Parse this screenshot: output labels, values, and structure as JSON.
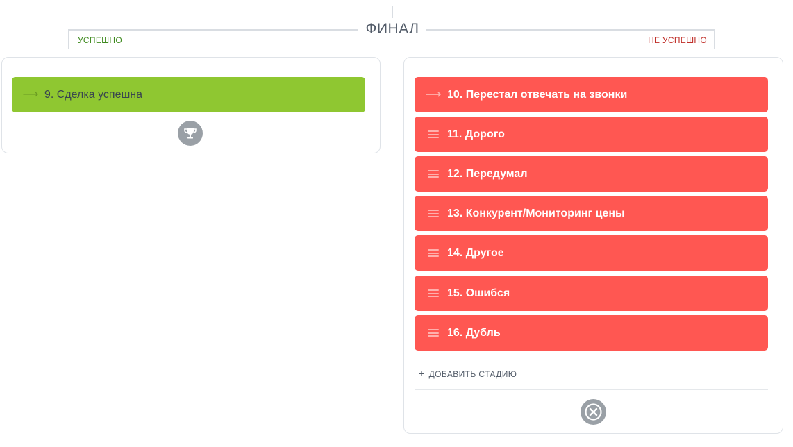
{
  "header": {
    "title": "ФИНАЛ",
    "success_label": "УСПЕШНО",
    "fail_label": "НЕ УСПЕШНО"
  },
  "success_stages": [
    {
      "label": "9. Сделка успешна",
      "icon": "arrow-right-icon"
    }
  ],
  "fail_stages": [
    {
      "label": "10. Перестал отвечать на звонки",
      "icon": "arrow-right-icon"
    },
    {
      "label": "11. Дорого",
      "icon": "drag-handle-icon"
    },
    {
      "label": "12. Передумал",
      "icon": "drag-handle-icon"
    },
    {
      "label": "13. Конкурент/Мониторинг цены",
      "icon": "drag-handle-icon"
    },
    {
      "label": "14. Другое",
      "icon": "drag-handle-icon"
    },
    {
      "label": "15. Ошибся",
      "icon": "drag-handle-icon"
    },
    {
      "label": "16. Дубль",
      "icon": "drag-handle-icon"
    }
  ],
  "actions": {
    "add_stage_label": "ДОБАВИТЬ СТАДИЮ"
  },
  "colors": {
    "success": "#8fc731",
    "fail": "#ff5752",
    "icon_circle": "#9aa0a6"
  }
}
